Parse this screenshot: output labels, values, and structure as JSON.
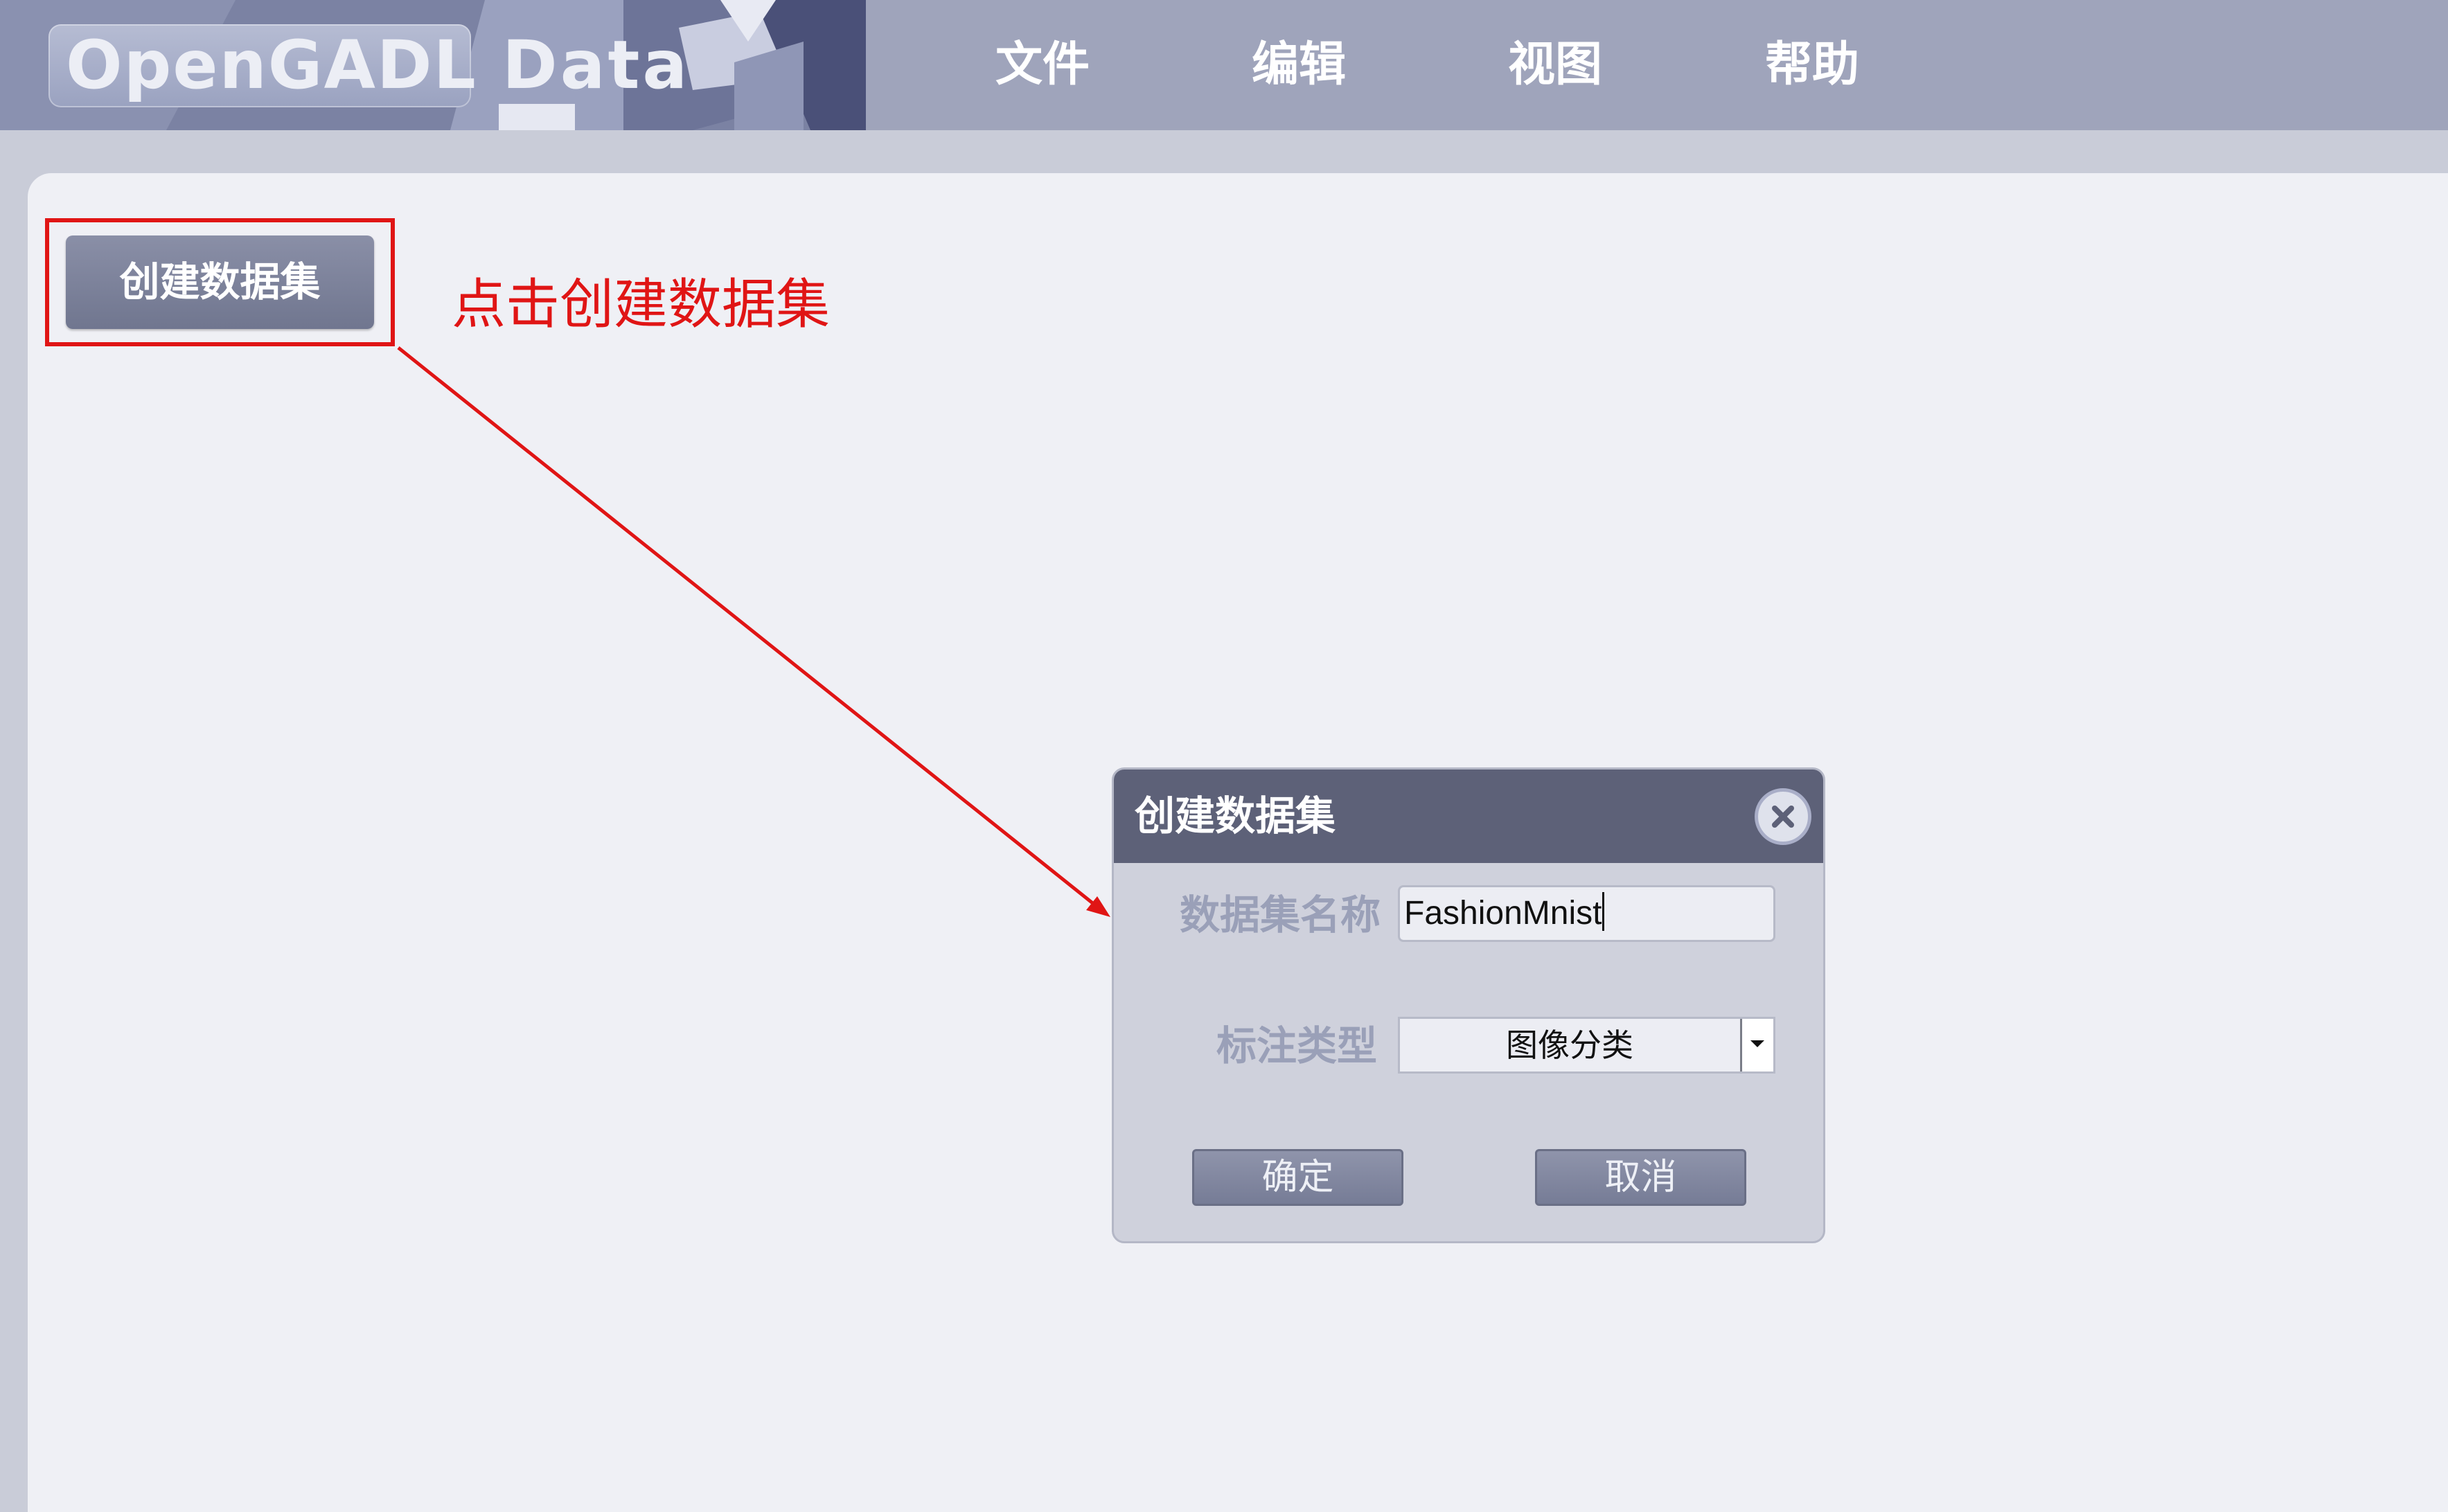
{
  "header": {
    "logo_main": "OpenGADL",
    "logo_sub": "Data",
    "menu": [
      "文件",
      "编辑",
      "视图",
      "帮助"
    ]
  },
  "page": {
    "create_button_label": "创建数据集",
    "annotation_text": "点击创建数据集"
  },
  "dialog": {
    "title": "创建数据集",
    "name_label": "数据集名称",
    "name_value": "FashionMnist",
    "type_label": "标注类型",
    "type_value": "图像分类",
    "confirm_label": "确定",
    "cancel_label": "取消"
  },
  "colors": {
    "header_bg": "#9fa4bb",
    "panel_bg": "#eff0f5",
    "dialog_title_bg": "#5d6178",
    "annotation_red": "#e01515"
  }
}
